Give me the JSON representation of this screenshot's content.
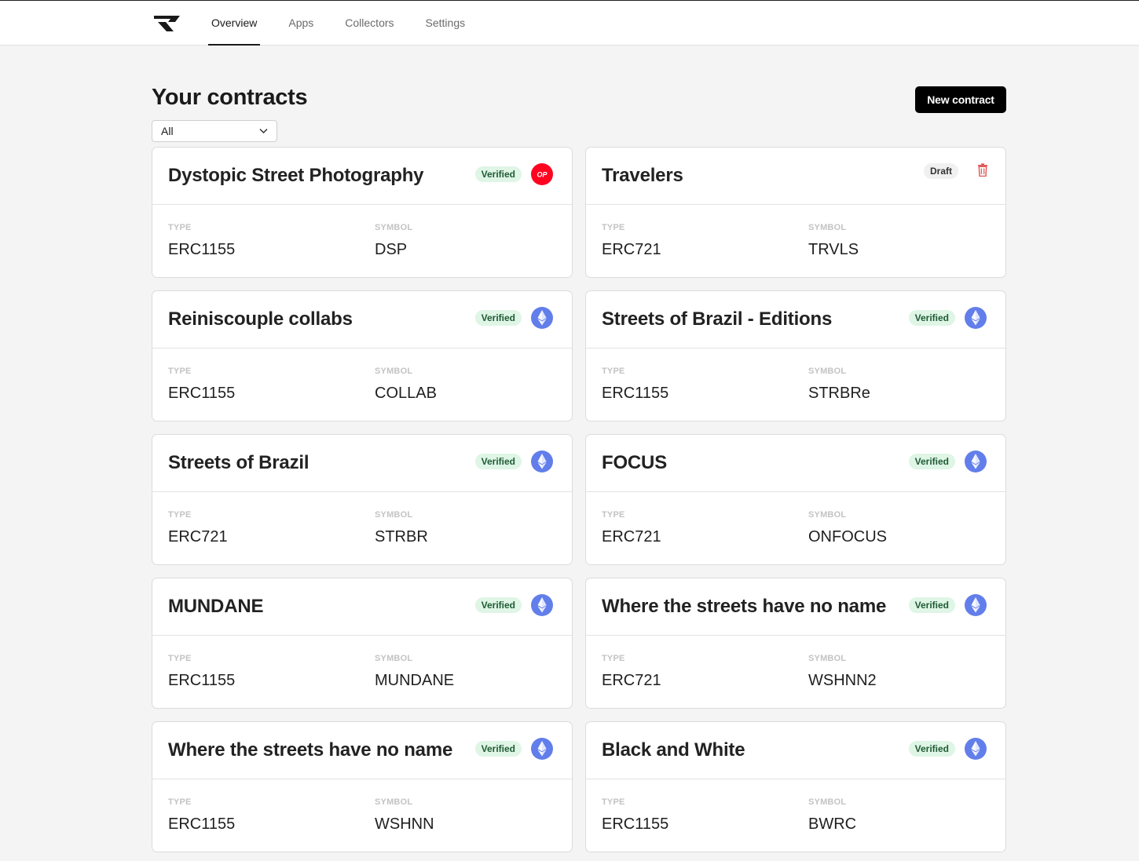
{
  "nav": {
    "logo_icon": "brand-logo-icon",
    "items": [
      {
        "label": "Overview",
        "active": true
      },
      {
        "label": "Apps",
        "active": false
      },
      {
        "label": "Collectors",
        "active": false
      },
      {
        "label": "Settings",
        "active": false
      }
    ]
  },
  "header": {
    "title": "Your contracts",
    "new_button_label": "New contract",
    "filter_value": "All"
  },
  "labels": {
    "type": "TYPE",
    "symbol": "SYMBOL"
  },
  "colors": {
    "verified_bg": "#dff5e6",
    "verified_text": "#1f5b34",
    "optimism_red": "#ff0420",
    "ethereum_blue": "#627eea",
    "delete_red": "#e05555"
  },
  "contracts": [
    {
      "name": "Dystopic Street Photography",
      "status": "Verified",
      "chain_icon": "optimism-icon",
      "chain_text": "OP",
      "type": "ERC1155",
      "symbol": "DSP"
    },
    {
      "name": "Travelers",
      "status": "Draft",
      "chain_icon": "trash-icon",
      "type": "ERC721",
      "symbol": "TRVLS"
    },
    {
      "name": "Reiniscouple collabs",
      "status": "Verified",
      "chain_icon": "ethereum-icon",
      "type": "ERC1155",
      "symbol": "COLLAB"
    },
    {
      "name": "Streets of Brazil - Editions",
      "status": "Verified",
      "chain_icon": "ethereum-icon",
      "type": "ERC1155",
      "symbol": "STRBRe"
    },
    {
      "name": "Streets of Brazil",
      "status": "Verified",
      "chain_icon": "ethereum-icon",
      "type": "ERC721",
      "symbol": "STRBR"
    },
    {
      "name": "FOCUS",
      "status": "Verified",
      "chain_icon": "ethereum-icon",
      "type": "ERC721",
      "symbol": "ONFOCUS"
    },
    {
      "name": "MUNDANE",
      "status": "Verified",
      "chain_icon": "ethereum-icon",
      "type": "ERC1155",
      "symbol": "MUNDANE"
    },
    {
      "name": "Where the streets have no name",
      "status": "Verified",
      "chain_icon": "ethereum-icon",
      "type": "ERC721",
      "symbol": "WSHNN2"
    },
    {
      "name": "Where the streets have no name",
      "status": "Verified",
      "chain_icon": "ethereum-icon",
      "type": "ERC1155",
      "symbol": "WSHNN"
    },
    {
      "name": "Black and White",
      "status": "Verified",
      "chain_icon": "ethereum-icon",
      "type": "ERC1155",
      "symbol": "BWRC"
    }
  ]
}
